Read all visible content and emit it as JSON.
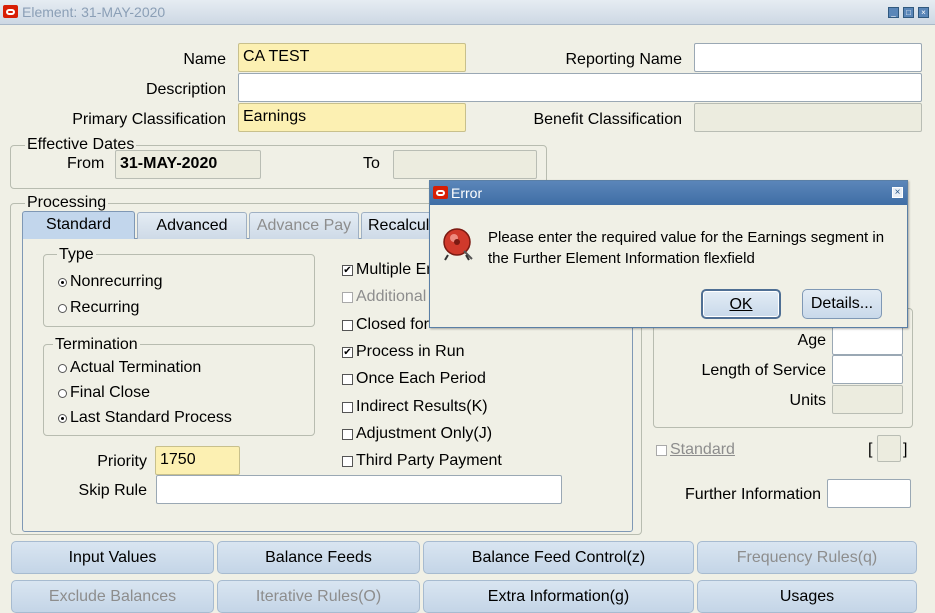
{
  "window": {
    "title": "Element: 31-MAY-2020",
    "controls": [
      "minimize-icon",
      "maximize-icon",
      "close-icon"
    ]
  },
  "header": {
    "name_label": "Name",
    "name_value": "CA TEST",
    "reporting_name_label": "Reporting Name",
    "reporting_name_value": "",
    "description_label": "Description",
    "description_value": "",
    "primary_classification_label": "Primary Classification",
    "primary_classification_value": "Earnings",
    "benefit_classification_label": "Benefit Classification",
    "benefit_classification_value": ""
  },
  "effective_dates": {
    "title": "Effective Dates",
    "from_label": "From",
    "from_value": "31-MAY-2020",
    "to_label": "To",
    "to_value": ""
  },
  "processing": {
    "title": "Processing",
    "tabs": [
      {
        "label": "Standard",
        "active": true,
        "enabled": true
      },
      {
        "label": "Advanced",
        "active": false,
        "enabled": true
      },
      {
        "label": "Advance Pay",
        "active": false,
        "enabled": false
      },
      {
        "label": "Recalcul",
        "active": false,
        "enabled": true
      }
    ],
    "type": {
      "title": "Type",
      "options": [
        {
          "label": "Nonrecurring",
          "checked": true
        },
        {
          "label": "Recurring",
          "checked": false
        }
      ]
    },
    "termination": {
      "title": "Termination",
      "options": [
        {
          "label": "Actual Termination",
          "checked": false
        },
        {
          "label": "Final Close",
          "checked": false
        },
        {
          "label": "Last Standard Process",
          "checked": true
        }
      ]
    },
    "checkboxes": [
      {
        "label": "Multiple Er",
        "checked": true,
        "enabled": true
      },
      {
        "label": "Additional",
        "checked": false,
        "enabled": false
      },
      {
        "label": "Closed for",
        "checked": false,
        "enabled": true
      },
      {
        "label": "Process in Run",
        "checked": true,
        "enabled": true
      },
      {
        "label": "Once Each Period",
        "checked": false,
        "enabled": true
      },
      {
        "label": "Indirect Results(K)",
        "checked": false,
        "enabled": true
      },
      {
        "label": "Adjustment Only(J)",
        "checked": false,
        "enabled": true
      },
      {
        "label": "Third Party Payment",
        "checked": false,
        "enabled": true
      }
    ],
    "priority_label": "Priority",
    "priority_value": "1750",
    "skip_rule_label": "Skip Rule",
    "skip_rule_value": ""
  },
  "qualifying": {
    "age_label": "Age",
    "age_value": "",
    "length_of_service_label": "Length of Service",
    "length_of_service_value": "",
    "units_label": "Units",
    "units_value": ""
  },
  "standard_checkbox": {
    "label": "Standard",
    "checked": false
  },
  "further_info": {
    "bracket_left": "[",
    "bracket_right": "]",
    "label": "Further Information",
    "value": ""
  },
  "bottom_buttons": [
    {
      "label": "Input Values",
      "enabled": true
    },
    {
      "label": "Balance Feeds",
      "enabled": true
    },
    {
      "label": "Balance Feed Control(z)",
      "enabled": true
    },
    {
      "label": "Frequency Rules(q)",
      "enabled": false
    },
    {
      "label": "Exclude Balances",
      "enabled": false
    },
    {
      "label": "Iterative Rules(O)",
      "enabled": false
    },
    {
      "label": "Extra Information(g)",
      "enabled": true
    },
    {
      "label": "Usages",
      "enabled": true
    }
  ],
  "error_dialog": {
    "title": "Error",
    "icon": "alarm-bell-icon",
    "message_line1": "Please enter the required value for the Earnings segment in",
    "message_line2": "the Further Element Information flexfield",
    "ok_label": "OK",
    "details_label": "Details..."
  },
  "colors": {
    "background": "#f0f0e6",
    "required_field": "#fcf0b2",
    "dialog_title": "#4a78ad",
    "oracle_red": "#d81e05"
  }
}
